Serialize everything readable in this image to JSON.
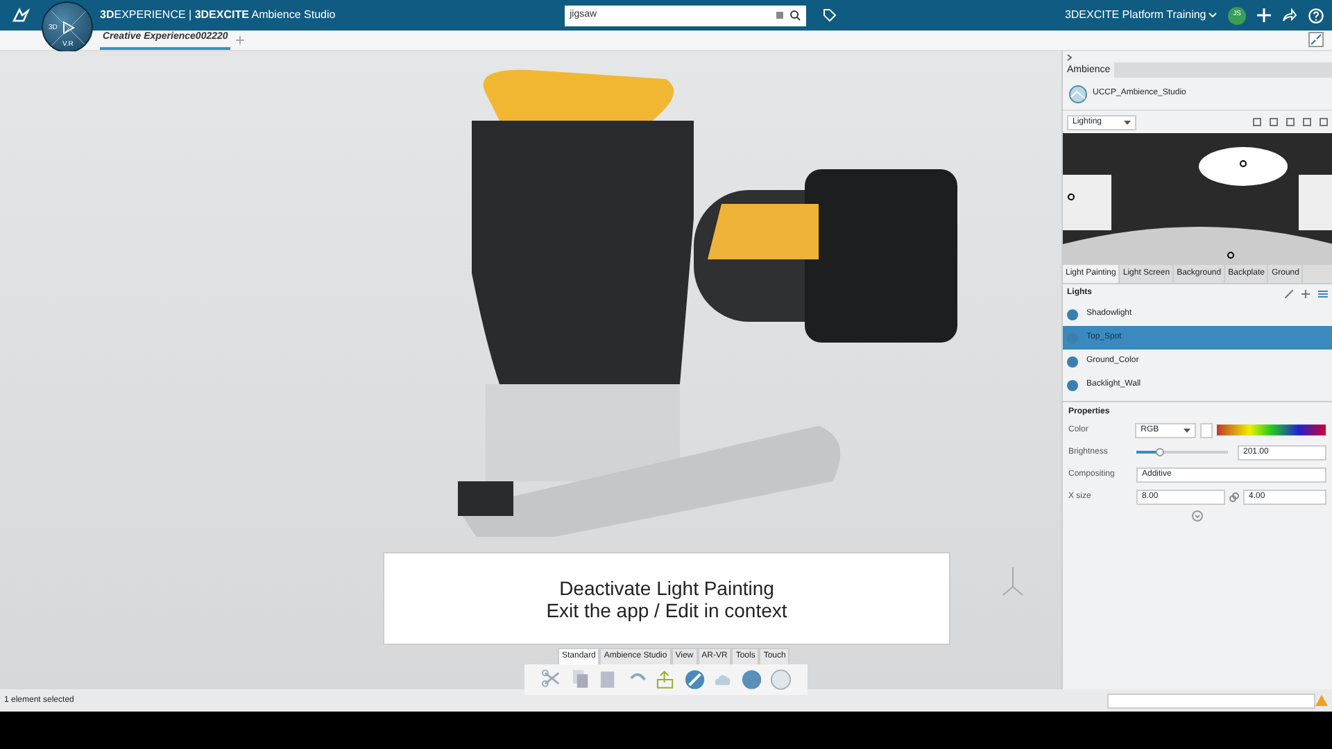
{
  "topbar": {
    "brand_bold": "3D",
    "brand": "EXPERIENCE | ",
    "app_bold": "3DEXCITE",
    "app": " Ambience Studio",
    "compass_left": "3D",
    "compass_version": "V.R",
    "search": {
      "value": "jigsaw"
    },
    "platform": "3DEXCITE Platform Training",
    "user_initials": "JS"
  },
  "doc_tabs": [
    {
      "label": "Creative Experience002220",
      "selected": true
    }
  ],
  "caption": {
    "lines": [
      "Deactivate Light Painting",
      "Exit the app / Edit in context"
    ]
  },
  "action_bar": {
    "tabs": [
      {
        "label": "Standard",
        "selected": true
      },
      {
        "label": "Ambience Studio",
        "selected": false
      },
      {
        "label": "View",
        "selected": false
      },
      {
        "label": "AR-VR",
        "selected": false
      },
      {
        "label": "Tools",
        "selected": false
      },
      {
        "label": "Touch",
        "selected": false
      }
    ]
  },
  "panel": {
    "title": "Ambience",
    "ambience_name": "UCCP_Ambience_Studio",
    "mode": "Lighting",
    "tabs": [
      {
        "label": "Light Painting",
        "selected": true
      },
      {
        "label": "Light Screen",
        "selected": false
      },
      {
        "label": "Background",
        "selected": false
      },
      {
        "label": "Backplate",
        "selected": false
      },
      {
        "label": "Ground",
        "selected": false
      }
    ],
    "lights_title": "Lights",
    "lights": [
      {
        "name": "Shadowlight",
        "selected": false
      },
      {
        "name": "Top_Spot",
        "selected": true
      },
      {
        "name": "Ground_Color",
        "selected": false
      },
      {
        "name": "Backlight_Wall",
        "selected": false
      }
    ],
    "properties_title": "Properties",
    "properties": [
      {
        "kind": "color",
        "label": "Color",
        "value": "RGB"
      },
      {
        "kind": "slider",
        "label": "Brightness",
        "level": 0.25,
        "value": "201.00"
      },
      {
        "kind": "select",
        "label": "Compositing",
        "value": "Additive"
      },
      {
        "kind": "pair",
        "label": "X size",
        "value": "8.00",
        "value2": "4.00"
      }
    ]
  },
  "status_bar": {
    "text": "1 element selected"
  }
}
